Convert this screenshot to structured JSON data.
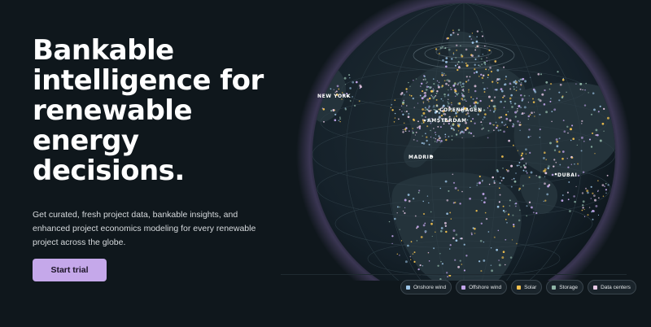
{
  "hero": {
    "title_lines": [
      "Bankable",
      "intelligence for",
      "renewable",
      "energy",
      "decisions."
    ],
    "subtitle": "Get curated, fresh project data, bankable insights, and enhanced project economics modeling for every renewable project across the globe.",
    "cta_label": "Start trial"
  },
  "globe": {
    "cities": [
      {
        "name": "NEW YORK"
      },
      {
        "name": "COPENHAGEN"
      },
      {
        "name": "AMSTERDAM"
      },
      {
        "name": "MADRID"
      },
      {
        "name": "DUBAI"
      }
    ]
  },
  "legend": {
    "items": [
      {
        "label": "Onshore wind",
        "color": "#9ec6e8"
      },
      {
        "label": "Offshore wind",
        "color": "#c2a5ea"
      },
      {
        "label": "Solar",
        "color": "#f2c14e"
      },
      {
        "label": "Storage",
        "color": "#8fb5a6"
      },
      {
        "label": "Data centers",
        "color": "#e6c8e4"
      }
    ]
  },
  "colors": {
    "background": "#0f171c",
    "accent": "#c5a8ea",
    "globe_glow": "#8b6fb8"
  }
}
